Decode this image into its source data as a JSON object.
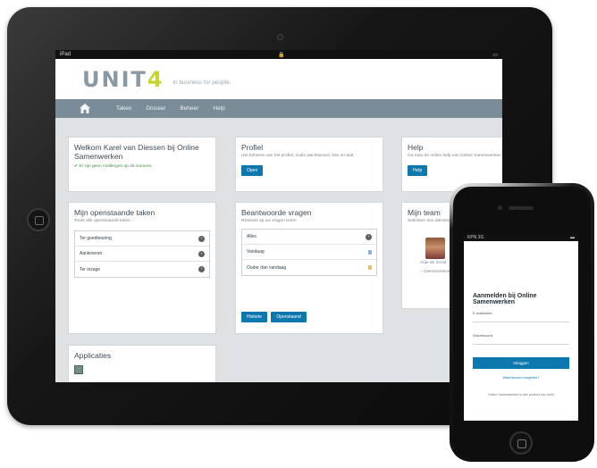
{
  "ipad": {
    "status": {
      "carrier": "iPad",
      "wifi": "wifi-icon",
      "lock": "lock-icon",
      "battery": "battery-icon"
    },
    "brand": {
      "logo_main": "UNIT",
      "logo_four": "4",
      "tagline": "in business for people."
    },
    "nav": {
      "home_icon": "home-icon",
      "items": [
        "Taken",
        "Dossier",
        "Beheer",
        "Help"
      ]
    },
    "welcome": {
      "title": "Welkom Karel van Diessen bij Online Samenwerken",
      "message": "✔ Er zijn geen meldingen op dit moment."
    },
    "profile": {
      "title": "Profiel",
      "description": "Het beheren van het profiel, zoals wachtwoord, foto en taal.",
      "button": "Open"
    },
    "help": {
      "title": "Help",
      "description": "Ga naar de online help van Online Samenwerken",
      "button": "Help"
    },
    "tasks": {
      "title": "Mijn openstaande taken",
      "subtitle": "Toont alle openstaande taken",
      "items": [
        "Ter goedkeuring",
        "Aanleveren",
        "Ter inzage"
      ]
    },
    "answered": {
      "title": "Beantwoorde vragen",
      "subtitle": "Reacties op uw vragen lezen",
      "items": [
        "Alles",
        "Vandaag",
        "Ouder dan vandaag"
      ],
      "btn_history": "Historie",
      "btn_open": "Openstaand"
    },
    "team": {
      "title": "Mijn team",
      "subtitle": "Selecteer een dienstverlener",
      "member": "Anje de Groot",
      "radio_label": "Dienstverlener"
    },
    "apps": {
      "title": "Applicaties"
    }
  },
  "iphone": {
    "status": {
      "carrier": "KPN 3G",
      "battery": "battery-icon"
    },
    "title": "Aanmelden bij Online Samenwerken",
    "email_label": "E-mailadres",
    "password_label": "Wachtwoord",
    "login_button": "Inloggen",
    "forgot_link": "Wachtwoord vergeten?",
    "footer": "Online Samenwerken is een product van Unit4"
  },
  "colors": {
    "accent_blue": "#0d78ae",
    "nav_gray": "#7a8c98",
    "logo_green": "#c7d531",
    "logo_gray": "#8a99a4"
  }
}
